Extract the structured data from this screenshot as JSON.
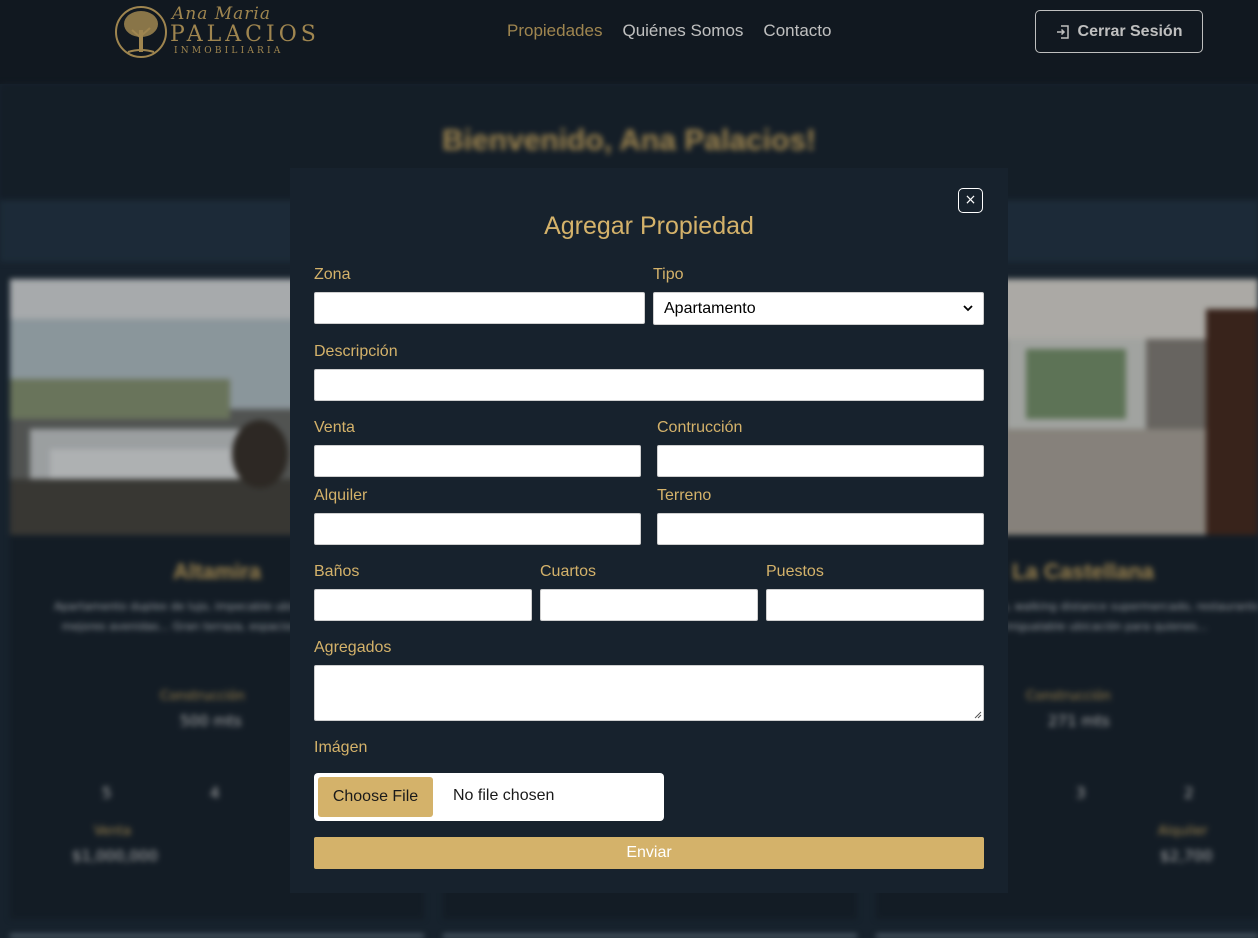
{
  "header": {
    "logo": {
      "script": "Ana Maria",
      "main": "PALACIOS",
      "sub": "INMOBILIARIA"
    },
    "nav": [
      {
        "label": "Propiedades",
        "active": true
      },
      {
        "label": "Quiénes Somos",
        "active": false
      },
      {
        "label": "Contacto",
        "active": false
      }
    ],
    "logout_label": "Cerrar Sesión"
  },
  "background": {
    "welcome": "Bienvenido, Ana Palacios!",
    "cards": [
      {
        "title": "Altamira",
        "description": "Apartamento duplex de lujo, impecable ubicación top en los mejores avenidas... Gran terraza, espacios de impecable.",
        "construction_label": "Construcción",
        "construction": "500 mts",
        "baths": "5",
        "rooms": "4",
        "sale_label": "Venta",
        "sale": "$1,000,000"
      },
      {
        "title": "La Castellana",
        "description": "... de La Castellana, walking distance supermercado, restaurantes, club ... inigualable ubicación para quienes...",
        "construction_label": "Construcción",
        "construction": "271 mts",
        "rooms": "3",
        "parking": "2",
        "rent_label": "Alquiler",
        "rent": "$2,700"
      }
    ]
  },
  "modal": {
    "close_label": "×",
    "title": "Agregar Propiedad",
    "fields": {
      "zona": {
        "label": "Zona",
        "value": ""
      },
      "tipo": {
        "label": "Tipo",
        "value": "Apartamento"
      },
      "descripcion": {
        "label": "Descripción",
        "value": ""
      },
      "venta": {
        "label": "Venta",
        "value": ""
      },
      "construccion": {
        "label": "Contrucción",
        "value": ""
      },
      "alquiler": {
        "label": "Alquiler",
        "value": ""
      },
      "terreno": {
        "label": "Terreno",
        "value": ""
      },
      "banos": {
        "label": "Baños",
        "value": ""
      },
      "cuartos": {
        "label": "Cuartos",
        "value": ""
      },
      "puestos": {
        "label": "Puestos",
        "value": ""
      },
      "agregados": {
        "label": "Agregados",
        "value": ""
      },
      "imagen": {
        "label": "Imágen",
        "button": "Choose File",
        "status": "No file chosen"
      }
    },
    "submit_label": "Enviar"
  },
  "colors": {
    "gold": "#d4b26a",
    "dark": "#17222d",
    "header": "#17212b"
  }
}
